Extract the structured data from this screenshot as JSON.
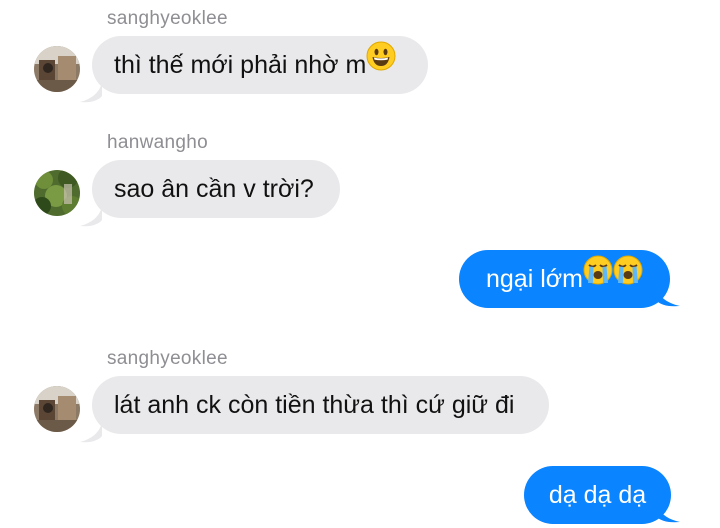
{
  "messages": [
    {
      "sender": "sanghyeoklee",
      "direction": "incoming",
      "text": "thì thế mới phải nhờ m",
      "emoji": [
        "grinning-face"
      ]
    },
    {
      "sender": "hanwangho",
      "direction": "incoming",
      "text": "sao ân cần v trời?"
    },
    {
      "direction": "outgoing",
      "text": "ngại lớm",
      "emoji": [
        "loudly-crying-face",
        "loudly-crying-face"
      ]
    },
    {
      "sender": "sanghyeoklee",
      "direction": "incoming",
      "text": "lát anh ck còn tiền thừa thì cứ giữ đi"
    },
    {
      "direction": "outgoing",
      "text": "dạ dạ dạ"
    }
  ],
  "colors": {
    "incoming_bubble": "#e9e9eb",
    "outgoing_bubble": "#0a84ff",
    "sender_name": "#8e8e93",
    "incoming_text": "#111111",
    "outgoing_text": "#ffffff"
  }
}
